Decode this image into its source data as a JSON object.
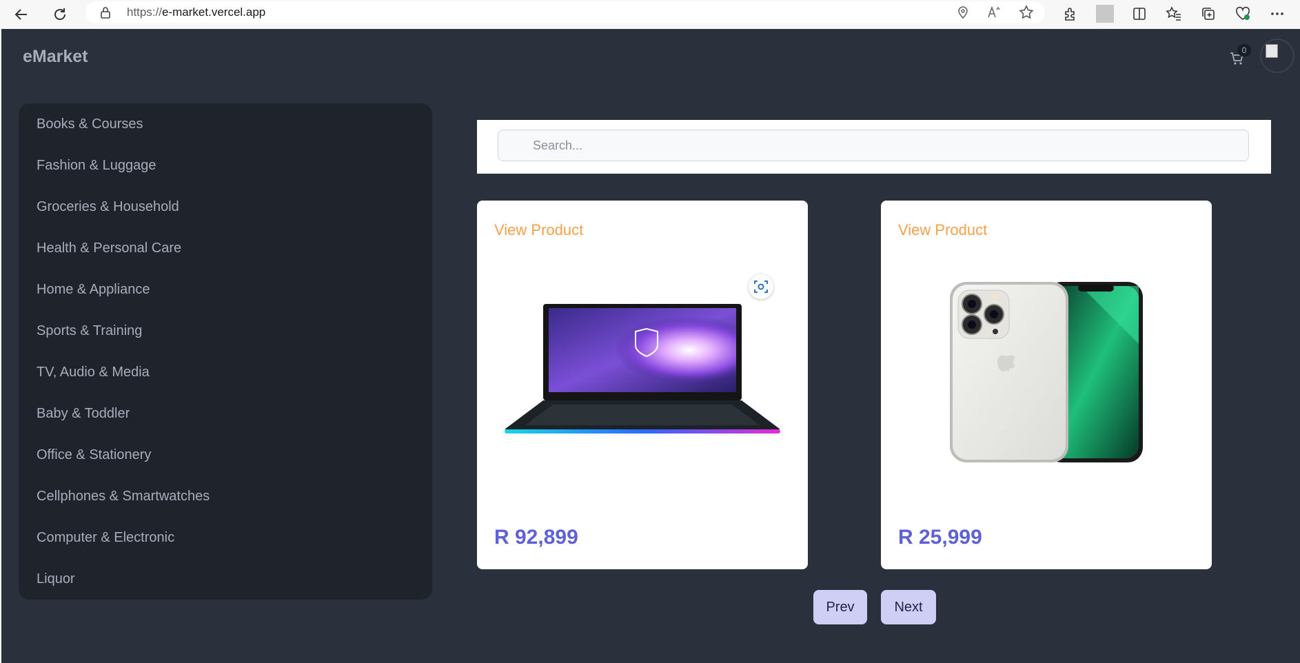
{
  "browser": {
    "url_protocol": "https://",
    "url_host": "e-market.vercel.app"
  },
  "app": {
    "brand": "eMarket",
    "cart_count": "0"
  },
  "sidebar": {
    "items": [
      {
        "label": "Books & Courses"
      },
      {
        "label": "Fashion & Luggage"
      },
      {
        "label": "Groceries & Household"
      },
      {
        "label": "Health & Personal Care"
      },
      {
        "label": "Home & Appliance"
      },
      {
        "label": "Sports & Training"
      },
      {
        "label": "TV, Audio & Media"
      },
      {
        "label": "Baby & Toddler"
      },
      {
        "label": "Office & Stationery"
      },
      {
        "label": "Cellphones & Smartwatches"
      },
      {
        "label": "Computer & Electronic"
      },
      {
        "label": "Liquor"
      }
    ]
  },
  "search": {
    "placeholder": "Search..."
  },
  "products": [
    {
      "link_label": "View Product",
      "price": "R 92,899",
      "image": "laptop"
    },
    {
      "link_label": "View Product",
      "price": "R 25,999",
      "image": "smartphone"
    }
  ],
  "pagination": {
    "prev_label": "Prev",
    "next_label": "Next"
  },
  "colors": {
    "app_bg": "#2a303c",
    "sidebar_bg": "#1f232c",
    "text_muted": "#a6adbb",
    "link_accent": "#f5a14a",
    "price_accent": "#6060d8",
    "pager_bg": "#cfcff5"
  }
}
